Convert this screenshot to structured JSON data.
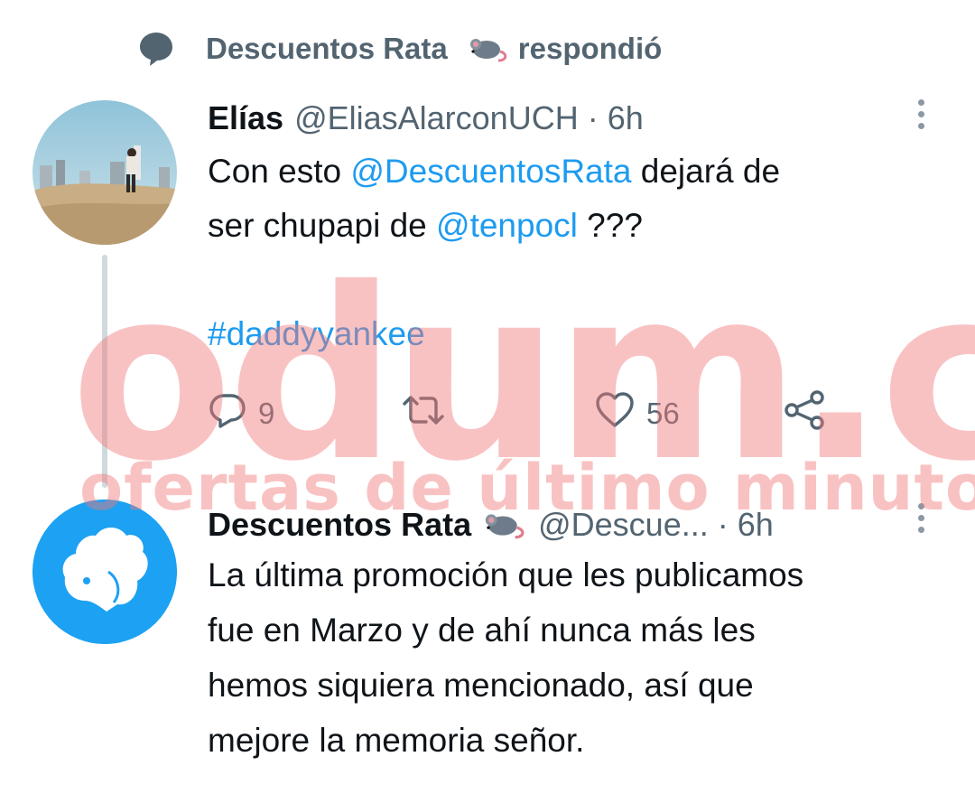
{
  "context": {
    "name": "Descuentos Rata",
    "action": "respondió",
    "icon": "speech-bubble-icon",
    "emoji": "rat-emoji"
  },
  "tweet1": {
    "name": "Elías",
    "handle": "@EliasAlarconUCH",
    "dot": "·",
    "time": "6h",
    "lines": [
      {
        "a": "Con esto ",
        "mention": "@DescuentosRata",
        "b": " dejará de"
      },
      {
        "a": "ser chupapi de ",
        "mention": "@tenpocl",
        "b": " ???"
      }
    ],
    "hashtag": "#daddyyankee",
    "replies": "9",
    "likes": "56"
  },
  "tweet2": {
    "name": "Descuentos Rata",
    "handle": "@Descue...",
    "dot": "·",
    "time": "6h",
    "lines": [
      "La última promoción que les publicamos",
      "fue en Marzo y de ahí nunca más les",
      "hemos siquiera mencionado, así que",
      "mejore la memoria señor."
    ]
  },
  "watermark": {
    "brand": "odum.cl",
    "tagline": "ofertas de último minuto"
  },
  "colors": {
    "link": "#1d9bf0",
    "secondary": "#536471",
    "watermark": "#f27878",
    "avatar2_bg": "#1da1f2"
  }
}
